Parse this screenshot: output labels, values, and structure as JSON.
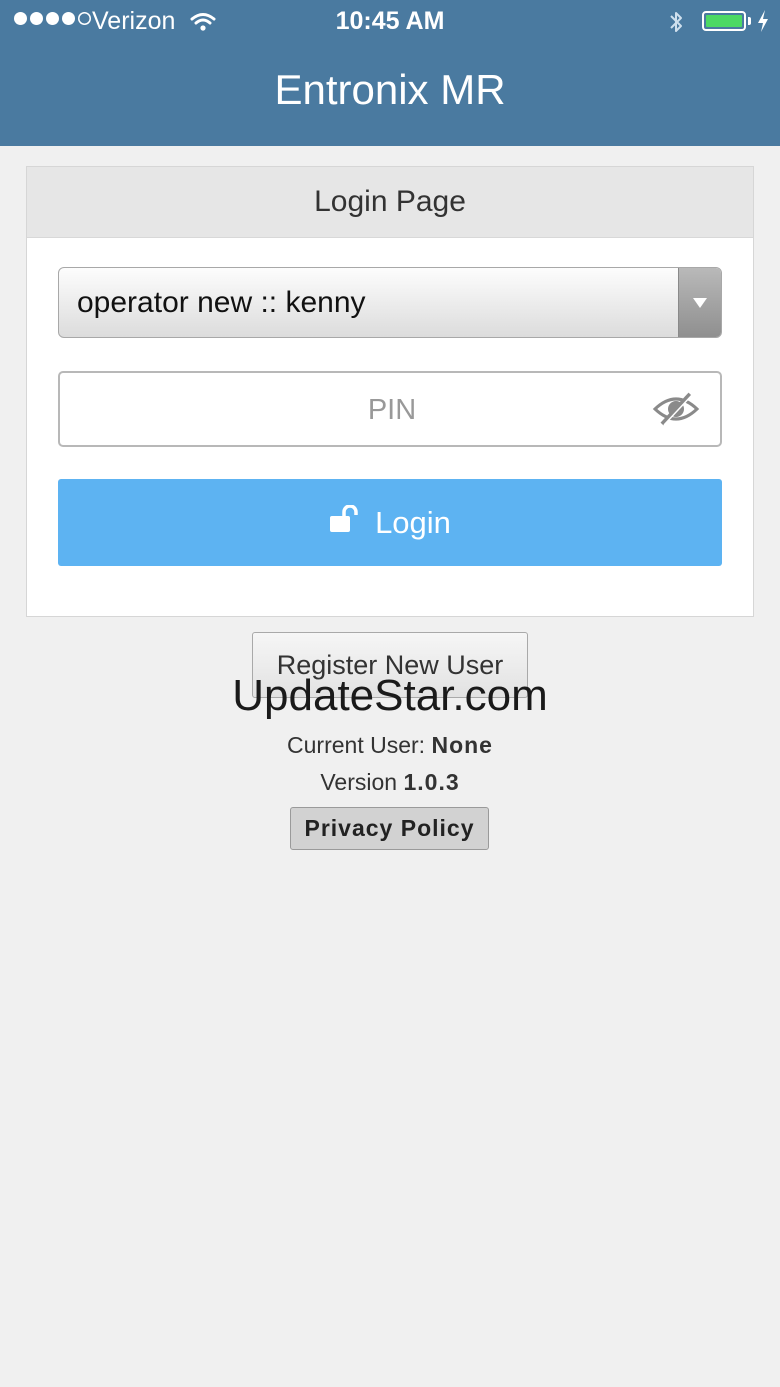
{
  "status_bar": {
    "carrier": "Verizon",
    "time": "10:45 AM",
    "signal_bars": 4,
    "signal_total": 5,
    "battery_level": 1.0
  },
  "header": {
    "title": "Entronix MR"
  },
  "login_card": {
    "title": "Login Page",
    "user_select": {
      "value": "operator new :: kenny"
    },
    "pin": {
      "placeholder": "PIN",
      "value": ""
    },
    "login_label": "Login"
  },
  "register_label": "Register New User",
  "watermark": "UpdateStar.com",
  "current_user": {
    "label": "Current User:",
    "value": "None"
  },
  "version": {
    "label": "Version",
    "value": "1.0.3"
  },
  "privacy_label": "Privacy Policy",
  "colors": {
    "header": "#4a7aa0",
    "login_button": "#5db3f2",
    "background": "#f0f0f0"
  },
  "icons": {
    "eye": "eye-slash-icon",
    "login": "unlock-icon",
    "select_arrow": "triangle-down-icon"
  }
}
